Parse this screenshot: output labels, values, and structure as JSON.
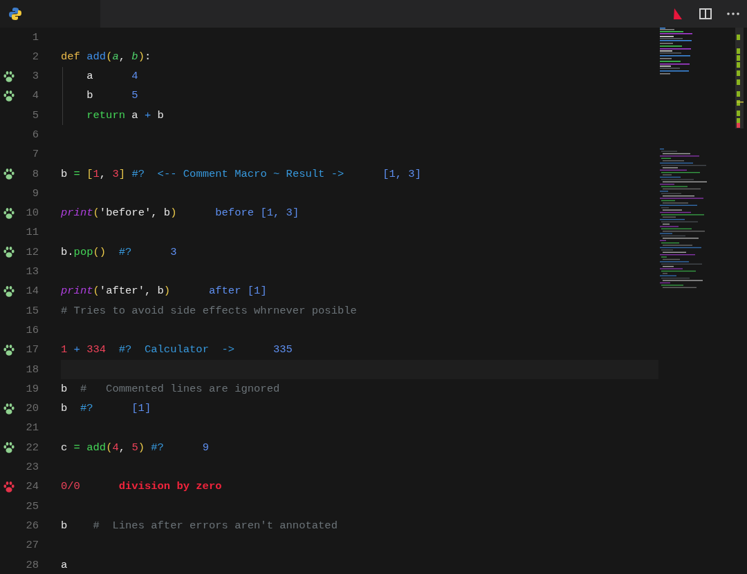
{
  "editor": {
    "lines": [
      {
        "number": "1",
        "annotated": false
      },
      {
        "number": "2",
        "annotated": false,
        "tokens": [
          {
            "text": "def ",
            "kind": "keyword"
          },
          {
            "text": "add",
            "kind": "func"
          },
          {
            "text": "(",
            "kind": "paren"
          },
          {
            "text": "a",
            "kind": "param"
          },
          {
            "text": ", ",
            "kind": "plain"
          },
          {
            "text": "b",
            "kind": "param"
          },
          {
            "text": ")",
            "kind": "paren"
          },
          {
            "text": ":",
            "kind": "plain"
          }
        ]
      },
      {
        "number": "3",
        "annotated": true,
        "error": false,
        "tokens": [
          {
            "text": "    a",
            "kind": "plain"
          }
        ],
        "result": {
          "text": "4",
          "kind": "value"
        }
      },
      {
        "number": "4",
        "annotated": true,
        "error": false,
        "tokens": [
          {
            "text": "    b",
            "kind": "plain"
          }
        ],
        "result": {
          "text": "5",
          "kind": "value"
        }
      },
      {
        "number": "5",
        "annotated": false,
        "tokens": [
          {
            "text": "    return",
            "kind": "green"
          },
          {
            "text": " a ",
            "kind": "plain"
          },
          {
            "text": "+",
            "kind": "func"
          },
          {
            "text": " b",
            "kind": "plain"
          }
        ]
      },
      {
        "number": "6",
        "annotated": false
      },
      {
        "number": "7",
        "annotated": false
      },
      {
        "number": "8",
        "annotated": true,
        "error": false,
        "tokens": [
          {
            "text": "b ",
            "kind": "plain"
          },
          {
            "text": "=",
            "kind": "green"
          },
          {
            "text": " [",
            "kind": "paren"
          },
          {
            "text": "1",
            "kind": "number"
          },
          {
            "text": ", ",
            "kind": "plain"
          },
          {
            "text": "3",
            "kind": "number"
          },
          {
            "text": "]",
            "kind": "paren"
          },
          {
            "text": " #?  <-- Comment Macro ~ Result ->",
            "kind": "macro"
          }
        ],
        "result": {
          "text": "[1, 3]",
          "kind": "value"
        }
      },
      {
        "number": "9",
        "annotated": false
      },
      {
        "number": "10",
        "annotated": true,
        "error": false,
        "tokens": [
          {
            "text": "print",
            "kind": "print"
          },
          {
            "text": "(",
            "kind": "paren"
          },
          {
            "text": "'before'",
            "kind": "plain"
          },
          {
            "text": ", b",
            "kind": "plain"
          },
          {
            "text": ")",
            "kind": "paren"
          }
        ],
        "result": {
          "text": "before [1, 3]",
          "kind": "value"
        }
      },
      {
        "number": "11",
        "annotated": false
      },
      {
        "number": "12",
        "annotated": true,
        "error": false,
        "tokens": [
          {
            "text": "b.",
            "kind": "plain"
          },
          {
            "text": "pop",
            "kind": "green"
          },
          {
            "text": "()",
            "kind": "paren"
          },
          {
            "text": "  #?",
            "kind": "macro"
          }
        ],
        "result": {
          "text": "3",
          "kind": "value"
        }
      },
      {
        "number": "13",
        "annotated": false
      },
      {
        "number": "14",
        "annotated": true,
        "error": false,
        "tokens": [
          {
            "text": "print",
            "kind": "print"
          },
          {
            "text": "(",
            "kind": "paren"
          },
          {
            "text": "'after'",
            "kind": "plain"
          },
          {
            "text": ", b",
            "kind": "plain"
          },
          {
            "text": ")",
            "kind": "paren"
          }
        ],
        "result": {
          "text": "after [1]",
          "kind": "value"
        }
      },
      {
        "number": "15",
        "annotated": false,
        "tokens": [
          {
            "text": "# Tries to avoid side effects whrnever posible",
            "kind": "comment"
          }
        ]
      },
      {
        "number": "16",
        "annotated": false
      },
      {
        "number": "17",
        "annotated": true,
        "error": false,
        "tokens": [
          {
            "text": "1",
            "kind": "number"
          },
          {
            "text": " +",
            "kind": "func"
          },
          {
            "text": " 334",
            "kind": "number"
          },
          {
            "text": "  #?  Calculator  ->",
            "kind": "macro"
          }
        ],
        "result": {
          "text": "335",
          "kind": "value"
        }
      },
      {
        "number": "18",
        "annotated": false,
        "current": true
      },
      {
        "number": "19",
        "annotated": false,
        "tokens": [
          {
            "text": "b  ",
            "kind": "plain"
          },
          {
            "text": "#   Commented lines are ignored",
            "kind": "comment"
          }
        ]
      },
      {
        "number": "20",
        "annotated": true,
        "error": false,
        "tokens": [
          {
            "text": "b  ",
            "kind": "plain"
          },
          {
            "text": "#?",
            "kind": "macro"
          }
        ],
        "result": {
          "text": "[1]",
          "kind": "value"
        }
      },
      {
        "number": "21",
        "annotated": false
      },
      {
        "number": "22",
        "annotated": true,
        "error": false,
        "tokens": [
          {
            "text": "c ",
            "kind": "plain"
          },
          {
            "text": "=",
            "kind": "green"
          },
          {
            "text": " add",
            "kind": "green"
          },
          {
            "text": "(",
            "kind": "paren"
          },
          {
            "text": "4",
            "kind": "number"
          },
          {
            "text": ", ",
            "kind": "plain"
          },
          {
            "text": "5",
            "kind": "number"
          },
          {
            "text": ")",
            "kind": "paren"
          },
          {
            "text": " #?",
            "kind": "macro"
          }
        ],
        "result": {
          "text": "9",
          "kind": "value"
        }
      },
      {
        "number": "23",
        "annotated": false
      },
      {
        "number": "24",
        "annotated": true,
        "error": true,
        "tokens": [
          {
            "text": "0/0",
            "kind": "number"
          }
        ],
        "result": {
          "text": "division by zero",
          "kind": "error"
        }
      },
      {
        "number": "25",
        "annotated": false
      },
      {
        "number": "26",
        "annotated": false,
        "tokens": [
          {
            "text": "b    ",
            "kind": "plain"
          },
          {
            "text": "#  Lines after errors aren't annotated",
            "kind": "comment"
          }
        ]
      },
      {
        "number": "27",
        "annotated": false
      },
      {
        "number": "28",
        "annotated": false,
        "tokens": [
          {
            "text": "a",
            "kind": "plain"
          }
        ]
      }
    ]
  }
}
